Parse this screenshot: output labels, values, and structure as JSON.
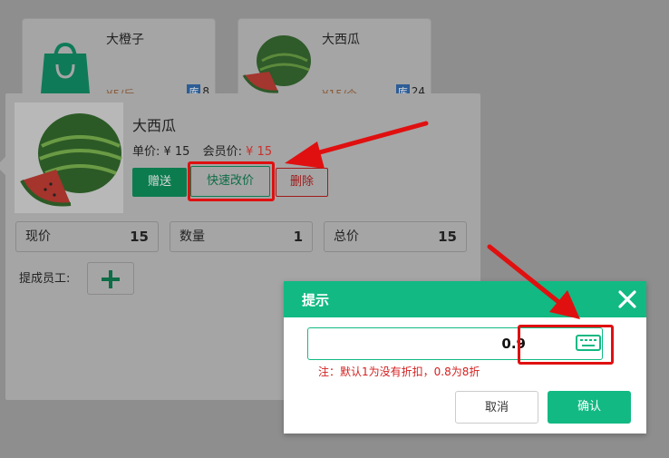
{
  "background_products": [
    {
      "name": "大橙子",
      "price": "¥5/斤",
      "stock_tag": "库",
      "stock": "8"
    },
    {
      "name": "大西瓜",
      "price": "¥15/个",
      "stock_tag": "库",
      "stock": "24"
    }
  ],
  "product": {
    "name": "大西瓜",
    "unit_price": "单价: ¥ 15",
    "member_label": "会员价:",
    "member_price": "¥ 15"
  },
  "actions": {
    "gift": "赠送",
    "quick_price": "快速改价",
    "delete": "删除"
  },
  "stats": [
    {
      "label": "现价",
      "value": "15"
    },
    {
      "label": "数量",
      "value": "1"
    },
    {
      "label": "总价",
      "value": "15"
    }
  ],
  "staff": {
    "label": "提成员工:"
  },
  "dialog": {
    "title": "提示",
    "input_value": "0.9",
    "note": "注：默认1为没有折扣，0.8为8折",
    "cancel": "取消",
    "confirm": "确认"
  },
  "colors": {
    "accent": "#12b983",
    "highlight": "#e01010",
    "note": "#d42020"
  }
}
